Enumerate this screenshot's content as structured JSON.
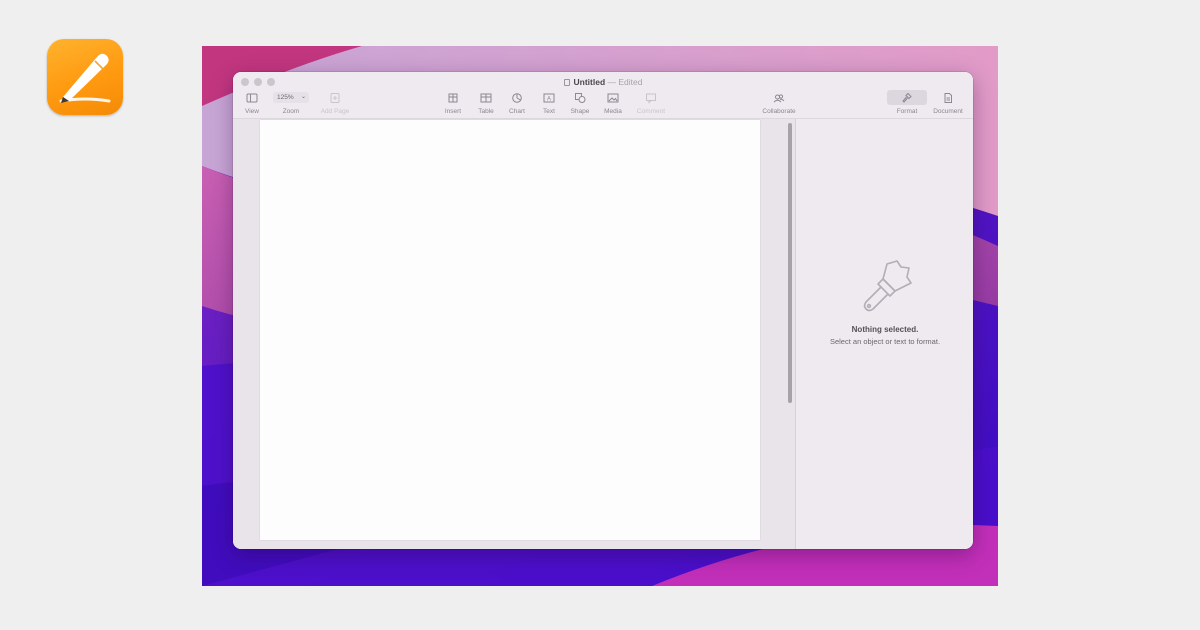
{
  "window": {
    "title": "Untitled",
    "edited": "— Edited"
  },
  "toolbar": {
    "view": "View",
    "zoom_value": "125%",
    "zoom": "Zoom",
    "add_page": "Add Page",
    "insert": "Insert",
    "table": "Table",
    "chart": "Chart",
    "text": "Text",
    "shape": "Shape",
    "media": "Media",
    "comment": "Comment",
    "collaborate": "Collaborate",
    "format": "Format",
    "document": "Document"
  },
  "inspector": {
    "title": "Nothing selected.",
    "subtitle": "Select an object or text to format."
  },
  "colors": {
    "accent": "#ff9a10",
    "wallpaper_magenta": "#c72c8c",
    "wallpaper_violet": "#4c0fcf"
  }
}
